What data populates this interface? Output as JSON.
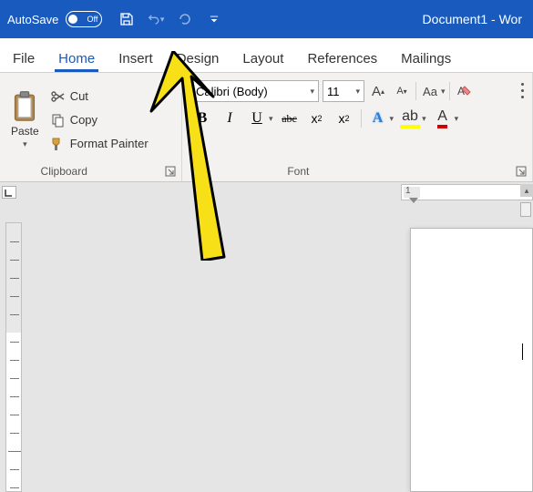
{
  "titlebar": {
    "autosave_label": "AutoSave",
    "autosave_state": "Off",
    "doc_title": "Document1  -  Wor"
  },
  "tabs": [
    {
      "label": "File",
      "active": false
    },
    {
      "label": "Home",
      "active": true
    },
    {
      "label": "Insert",
      "active": false
    },
    {
      "label": "Design",
      "active": false
    },
    {
      "label": "Layout",
      "active": false
    },
    {
      "label": "References",
      "active": false
    },
    {
      "label": "Mailings",
      "active": false
    }
  ],
  "ribbon": {
    "clipboard": {
      "paste_label": "Paste",
      "cut_label": "Cut",
      "copy_label": "Copy",
      "format_painter_label": "Format Painter",
      "group_label": "Clipboard"
    },
    "font": {
      "font_name": "Calibri (Body)",
      "font_size": "11",
      "group_label": "Font",
      "change_case": "Aa",
      "bold": "B",
      "italic": "I",
      "underline": "U",
      "strike": "abc",
      "subscript": "x",
      "subscript_sub": "2",
      "superscript": "x",
      "superscript_sup": "2",
      "text_effects": "A",
      "highlight": "A",
      "font_color": "A",
      "grow": "A",
      "shrink": "A"
    }
  },
  "ruler": {
    "h_num": "1"
  }
}
